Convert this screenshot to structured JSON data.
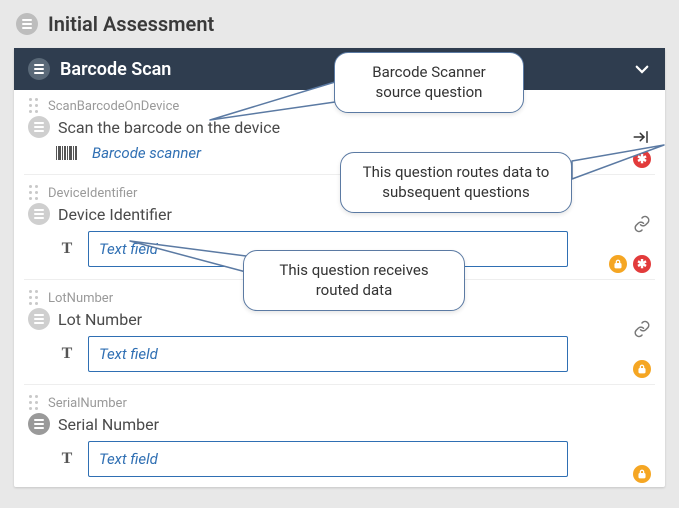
{
  "page": {
    "title": "Initial Assessment"
  },
  "section": {
    "title": "Barcode Scan"
  },
  "questions": [
    {
      "id": "ScanBarcodeOnDevice",
      "label": "Scan the barcode on the device",
      "field_label": "Barcode scanner"
    },
    {
      "id": "DeviceIdentifier",
      "label": "Device Identifier",
      "placeholder": "Text field"
    },
    {
      "id": "LotNumber",
      "label": "Lot Number",
      "placeholder": "Text field"
    },
    {
      "id": "SerialNumber",
      "label": "Serial Number",
      "placeholder": "Text field"
    }
  ],
  "callouts": {
    "c1": "Barcode Scanner source question",
    "c2": "This question routes data to subsequent questions",
    "c3": "This question receives routed data"
  },
  "icons": {
    "required": "✱",
    "lock": "🔒"
  }
}
